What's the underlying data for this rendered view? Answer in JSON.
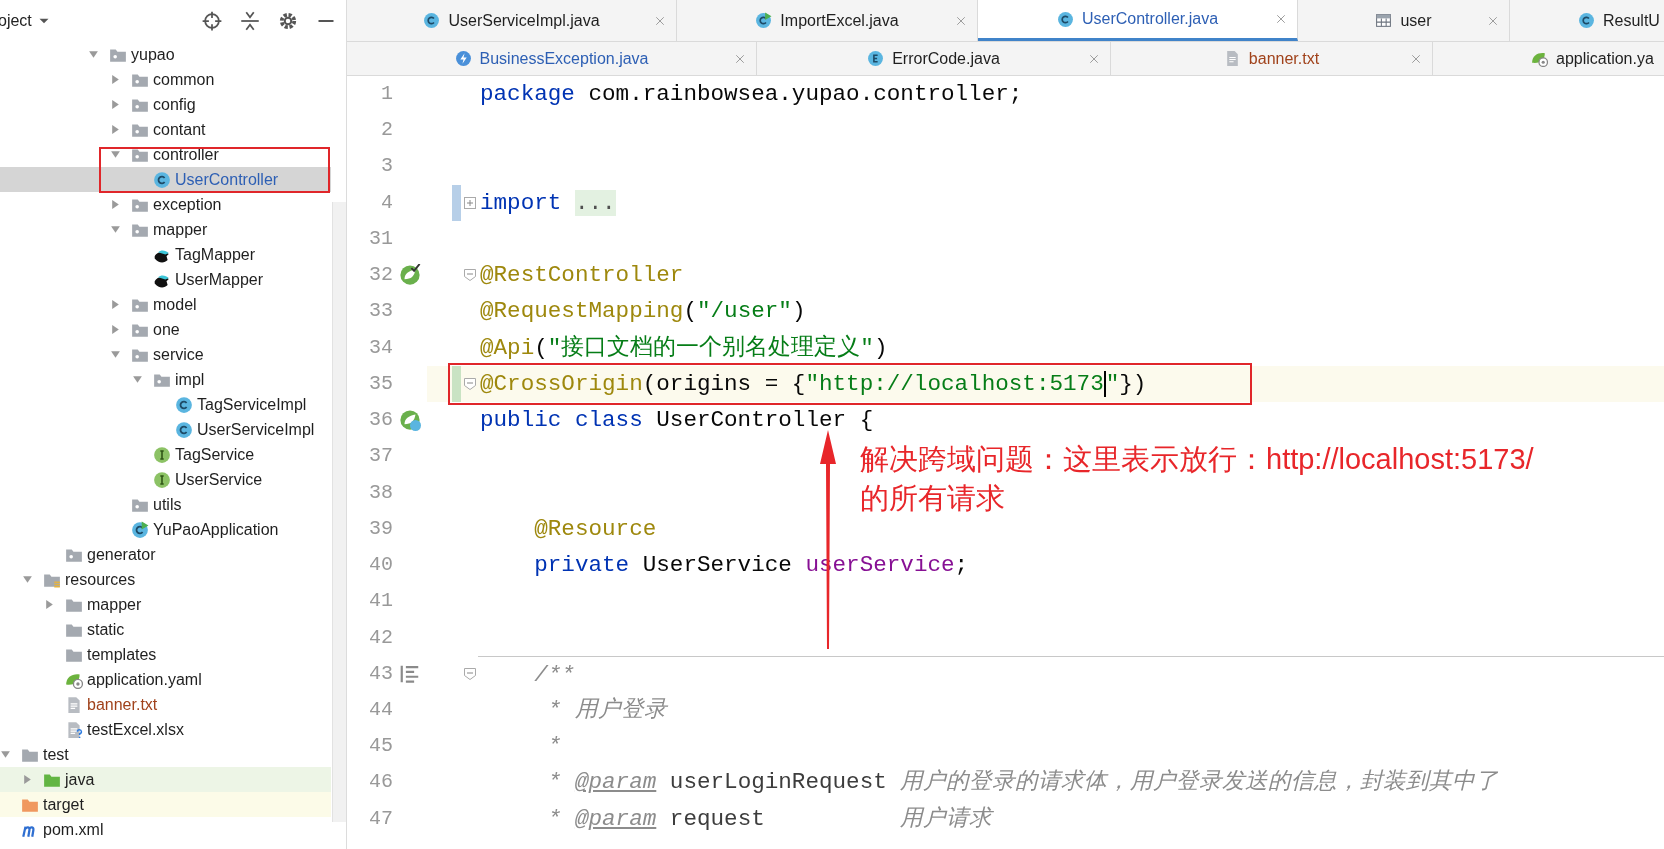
{
  "project_panel": {
    "title": "oject",
    "tree": [
      {
        "children": [
          {
            "children": [
              {
                "children": [
                  {
                    "children": [
                      {
                        "label": "yupao",
                        "kind": "package",
                        "expanded": true,
                        "selected": false,
                        "children": [
                          {
                            "label": "common",
                            "kind": "package",
                            "expanded": false,
                            "selected": false
                          },
                          {
                            "label": "config",
                            "kind": "package",
                            "expanded": false,
                            "selected": false
                          },
                          {
                            "label": "contant",
                            "kind": "package",
                            "expanded": false,
                            "selected": false
                          },
                          {
                            "label": "controller",
                            "kind": "package",
                            "expanded": true,
                            "selected": false,
                            "children": [
                              {
                                "label": "UserController",
                                "kind": "class",
                                "selected": true,
                                "color": "#2d5fb4"
                              }
                            ]
                          },
                          {
                            "label": "exception",
                            "kind": "package",
                            "expanded": false,
                            "selected": false
                          },
                          {
                            "label": "mapper",
                            "kind": "package",
                            "expanded": true,
                            "selected": false,
                            "children": [
                              {
                                "label": "TagMapper",
                                "kind": "mapper",
                                "selected": false
                              },
                              {
                                "label": "UserMapper",
                                "kind": "mapper",
                                "selected": false
                              }
                            ]
                          },
                          {
                            "label": "model",
                            "kind": "package",
                            "expanded": false,
                            "selected": false
                          },
                          {
                            "label": "one",
                            "kind": "package",
                            "expanded": false,
                            "selected": false
                          },
                          {
                            "label": "service",
                            "kind": "package",
                            "expanded": true,
                            "selected": false,
                            "children": [
                              {
                                "label": "impl",
                                "kind": "package",
                                "expanded": true,
                                "selected": false,
                                "children": [
                                  {
                                    "label": "TagServiceImpl",
                                    "kind": "class",
                                    "selected": false
                                  },
                                  {
                                    "label": "UserServiceImpl",
                                    "kind": "class",
                                    "selected": false
                                  }
                                ]
                              },
                              {
                                "label": "TagService",
                                "kind": "interface",
                                "selected": false
                              },
                              {
                                "label": "UserService",
                                "kind": "interface",
                                "selected": false
                              }
                            ]
                          },
                          {
                            "label": "utils",
                            "kind": "package",
                            "selected": false
                          },
                          {
                            "label": "YuPaoApplication",
                            "kind": "spring-class",
                            "selected": false
                          }
                        ]
                      }
                    ]
                  }
                ]
              },
              {
                "label": "generator",
                "kind": "package",
                "selected": false
              }
            ]
          },
          {
            "label": "resources",
            "kind": "resources-folder",
            "expanded": true,
            "selected": false,
            "children": [
              {
                "label": "mapper",
                "kind": "folder",
                "expanded": false,
                "selected": false
              },
              {
                "label": "static",
                "kind": "folder",
                "selected": false
              },
              {
                "label": "templates",
                "kind": "folder",
                "selected": false
              },
              {
                "label": "application.yaml",
                "kind": "yaml",
                "selected": false
              },
              {
                "label": "banner.txt",
                "kind": "text",
                "selected": false,
                "color": "#a0421b"
              },
              {
                "label": "testExcel.xlsx",
                "kind": "unknown",
                "selected": false
              }
            ]
          }
        ]
      },
      {
        "label": "test",
        "kind": "folder",
        "expanded": true,
        "selected": false,
        "children": [
          {
            "label": "java",
            "kind": "test-folder",
            "expanded": false,
            "selected": false,
            "highlight": {
              "color": "#edf5e6"
            }
          }
        ]
      },
      {
        "label": "target",
        "kind": "excluded-folder",
        "selected": false,
        "highlight": {
          "color": "#fcfbe8"
        }
      },
      {
        "label": "pom.xml",
        "kind": "maven",
        "selected": false
      }
    ]
  },
  "tab_rows": [
    [
      {
        "label": "UserServiceImpl.java",
        "kind": "class",
        "selected": false,
        "closable": true,
        "color": "#1f1f1f"
      },
      {
        "label": "ImportExcel.java",
        "kind": "class-run",
        "selected": false,
        "closable": true,
        "color": "#1f1f1f"
      },
      {
        "label": "UserController.java",
        "kind": "class",
        "selected": true,
        "closable": true,
        "color": "#2d5fb4"
      },
      {
        "label": "user",
        "kind": "table",
        "selected": false,
        "closable": true,
        "color": "#1f1f1f"
      },
      {
        "label": "ResultU",
        "kind": "class",
        "selected": false,
        "closable": false,
        "color": "#1f1f1f"
      }
    ],
    [
      {
        "label": "BusinessException.java",
        "kind": "exception",
        "selected": false,
        "closable": true,
        "color": "#2d5fb4"
      },
      {
        "label": "ErrorCode.java",
        "kind": "enum",
        "selected": false,
        "closable": true,
        "color": "#1f1f1f"
      },
      {
        "label": "banner.txt",
        "kind": "text",
        "selected": false,
        "closable": true,
        "color": "#a0421b"
      },
      {
        "label": "application.ya",
        "kind": "yaml",
        "selected": false,
        "closable": false,
        "color": "#1f1f1f"
      }
    ]
  ],
  "editor": {
    "lines": [
      {
        "number": "1",
        "current": false,
        "separator_above": false,
        "segments": [
          {
            "kind": "kw",
            "text": "package"
          },
          {
            "kind": "plain",
            "text": " com.rainbowsea.yupao.controller;"
          }
        ]
      },
      {
        "number": "2",
        "current": false,
        "separator_above": false
      },
      {
        "number": "3",
        "current": false,
        "separator_above": false
      },
      {
        "number": "4",
        "current": false,
        "separator_above": false,
        "change": {
          "color": "#b7cfe8"
        },
        "fold": {
          "kind": "expand"
        },
        "segments": [
          {
            "kind": "kw",
            "text": "import "
          },
          {
            "kind": "fold",
            "text": "..."
          }
        ]
      },
      {
        "number": "31",
        "current": false,
        "separator_above": false
      },
      {
        "number": "32",
        "current": false,
        "separator_above": false,
        "gutter": {
          "kind": "bean"
        },
        "fold": {
          "kind": "start"
        },
        "segments": [
          {
            "kind": "anno",
            "text": "@RestController"
          }
        ]
      },
      {
        "number": "33",
        "current": false,
        "separator_above": false,
        "segments": [
          {
            "kind": "anno",
            "text": "@RequestMapping"
          },
          {
            "kind": "plain",
            "text": "("
          },
          {
            "kind": "str",
            "text": "\"/user\""
          },
          {
            "kind": "plain",
            "text": ")"
          }
        ]
      },
      {
        "number": "34",
        "current": false,
        "separator_above": false,
        "segments": [
          {
            "kind": "anno",
            "text": "@Api"
          },
          {
            "kind": "plain",
            "text": "("
          },
          {
            "kind": "str",
            "text": "\"接口文档的一个别名处理定义\""
          },
          {
            "kind": "plain",
            "text": ")"
          }
        ]
      },
      {
        "number": "35",
        "current": true,
        "separator_above": false,
        "change": {
          "color": "#c9e3c3"
        },
        "fold": {
          "kind": "start"
        },
        "segments": [
          {
            "kind": "anno",
            "text": "@CrossOrigin"
          },
          {
            "kind": "plain",
            "text": "(origins = {"
          },
          {
            "kind": "str",
            "text": "\"http://localhost:5173",
            "caret_after": true
          },
          {
            "kind": "str",
            "text": "\""
          },
          {
            "kind": "plain",
            "text": "})"
          }
        ]
      },
      {
        "number": "36",
        "current": false,
        "separator_above": false,
        "gutter": {
          "kind": "spring-class"
        },
        "segments": [
          {
            "kind": "kw",
            "text": "public class"
          },
          {
            "kind": "plain",
            "text": " UserController {"
          }
        ]
      },
      {
        "number": "37",
        "current": false,
        "separator_above": false
      },
      {
        "number": "38",
        "current": false,
        "separator_above": false
      },
      {
        "number": "39",
        "current": false,
        "separator_above": false,
        "segments": [
          {
            "kind": "anno",
            "text": "    @Resource"
          }
        ]
      },
      {
        "number": "40",
        "current": false,
        "separator_above": false,
        "segments": [
          {
            "kind": "kw",
            "text": "    private"
          },
          {
            "kind": "plain",
            "text": " UserService "
          },
          {
            "kind": "field",
            "text": "userService"
          },
          {
            "kind": "plain",
            "text": ";"
          }
        ]
      },
      {
        "number": "41",
        "current": false,
        "separator_above": false
      },
      {
        "number": "42",
        "current": false,
        "separator_above": false
      },
      {
        "number": "43",
        "current": false,
        "separator_above": true,
        "gutter": {
          "kind": "structure"
        },
        "fold": {
          "kind": "start"
        },
        "segments": [
          {
            "kind": "comment",
            "text": "    /**"
          }
        ]
      },
      {
        "number": "44",
        "current": false,
        "separator_above": false,
        "segments": [
          {
            "kind": "comment",
            "text": "     * 用户登录"
          }
        ]
      },
      {
        "number": "45",
        "current": false,
        "separator_above": false,
        "segments": [
          {
            "kind": "comment",
            "text": "     *"
          }
        ]
      },
      {
        "number": "46",
        "current": false,
        "separator_above": false,
        "segments": [
          {
            "kind": "comment",
            "text": "     * "
          },
          {
            "kind": "doctag",
            "text": "@param"
          },
          {
            "kind": "docparam",
            "text": " userLoginRequest"
          },
          {
            "kind": "comment",
            "text": " 用户的登录的请求体，用户登录发送的信息，封装到其中了"
          }
        ]
      },
      {
        "number": "47",
        "current": false,
        "separator_above": false,
        "segments": [
          {
            "kind": "comment",
            "text": "     * "
          },
          {
            "kind": "doctag",
            "text": "@param"
          },
          {
            "kind": "docparam",
            "text": " request"
          },
          {
            "kind": "comment",
            "text": "          用户请求"
          }
        ]
      }
    ]
  },
  "callout": {
    "lines": [
      "解决跨域问题：这里表示放行：http://localhost:5173/",
      "的所有请求"
    ]
  }
}
